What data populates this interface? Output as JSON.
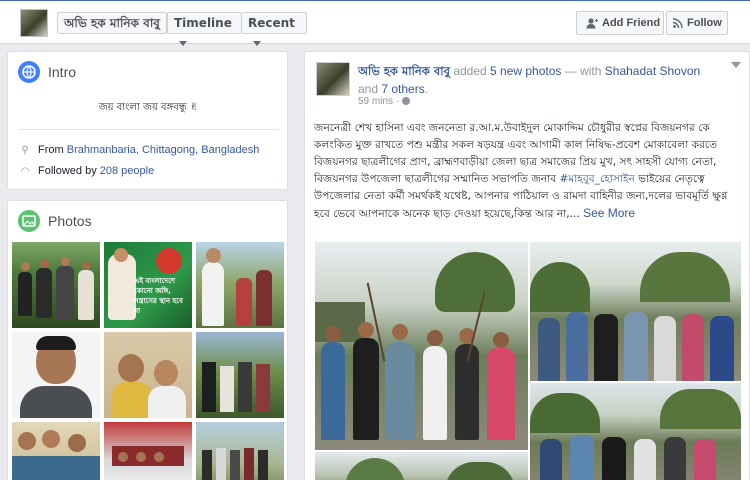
{
  "topbar": {
    "name_label": "অভি হক মানিক বাবু",
    "timeline_label": "Timeline",
    "recent_label": "Recent",
    "add_friend_label": "Add Friend",
    "follow_label": "Follow"
  },
  "intro": {
    "title": "Intro",
    "bio": "জয় বাংলা জয় বঙ্গবন্ধু ✌",
    "from_prefix": "From ",
    "from_place": "Brahmanbaria, Chittagong, Bangladesh",
    "followed_prefix": "Followed by ",
    "followed_count": "208 people"
  },
  "photos": {
    "title": "Photos",
    "tile2_text": "এই বাংলাদেশে কোনো জঙ্গি, সন্ত্রাসের স্থান হবে না"
  },
  "post": {
    "author": "অভি হক মানিক বাবু",
    "action_added": " added ",
    "action_photos": "5 new photos",
    "action_with": " — with ",
    "tagged_person": "Shahadat Shovon",
    "and": " and ",
    "others": "7 others",
    "period": ".",
    "time": "59 mins · ",
    "body": "জননেত্রী শেখ হাসিনা এবং জননেতা র.আ.ম.উবাইদুল মোকাদ্দিম চৌধুরীর স্বপ্নের বিজয়নগর কে কলংকিত মুক্ত রাখতে পশু মন্ত্রীর সকল ষড়যন্ত্র এবং আগামী কাল নিষিদ্ধ-প্রবেশ মোকাবেলা করতে বিজয়নগর ছাত্রলীগের প্রাণ, ব্রাহ্মণবাড়ীয়া জেলা ছাত্র সমাজের প্রিয় মুখ, সৎ সাহসী যোগ্য নেতা, বিজয়নগর উপজেলা ছাত্রলীগের সম্মানিত সভাপতি জনাব ",
    "hashtag": "#মাহবুব_হোসাইন",
    "body2": " ভাইয়ের নেতৃত্বে উপজেলার নেতা কর্মী সমর্থকই যথেষ্ট, আপনার পাঠিয়াল ও রামদা বাহিনীর জন্য,দলের ভাবমূর্তি ক্ষুণ্ণ হবে ভেবে আপনাকে অনেক ছাড় দেওয়া হয়েছে,কিন্ত আর না,... ",
    "see_more": "See More"
  },
  "colors": {
    "link": "#365899",
    "brand": "#4267b2",
    "page_bg": "#e9ebee"
  }
}
